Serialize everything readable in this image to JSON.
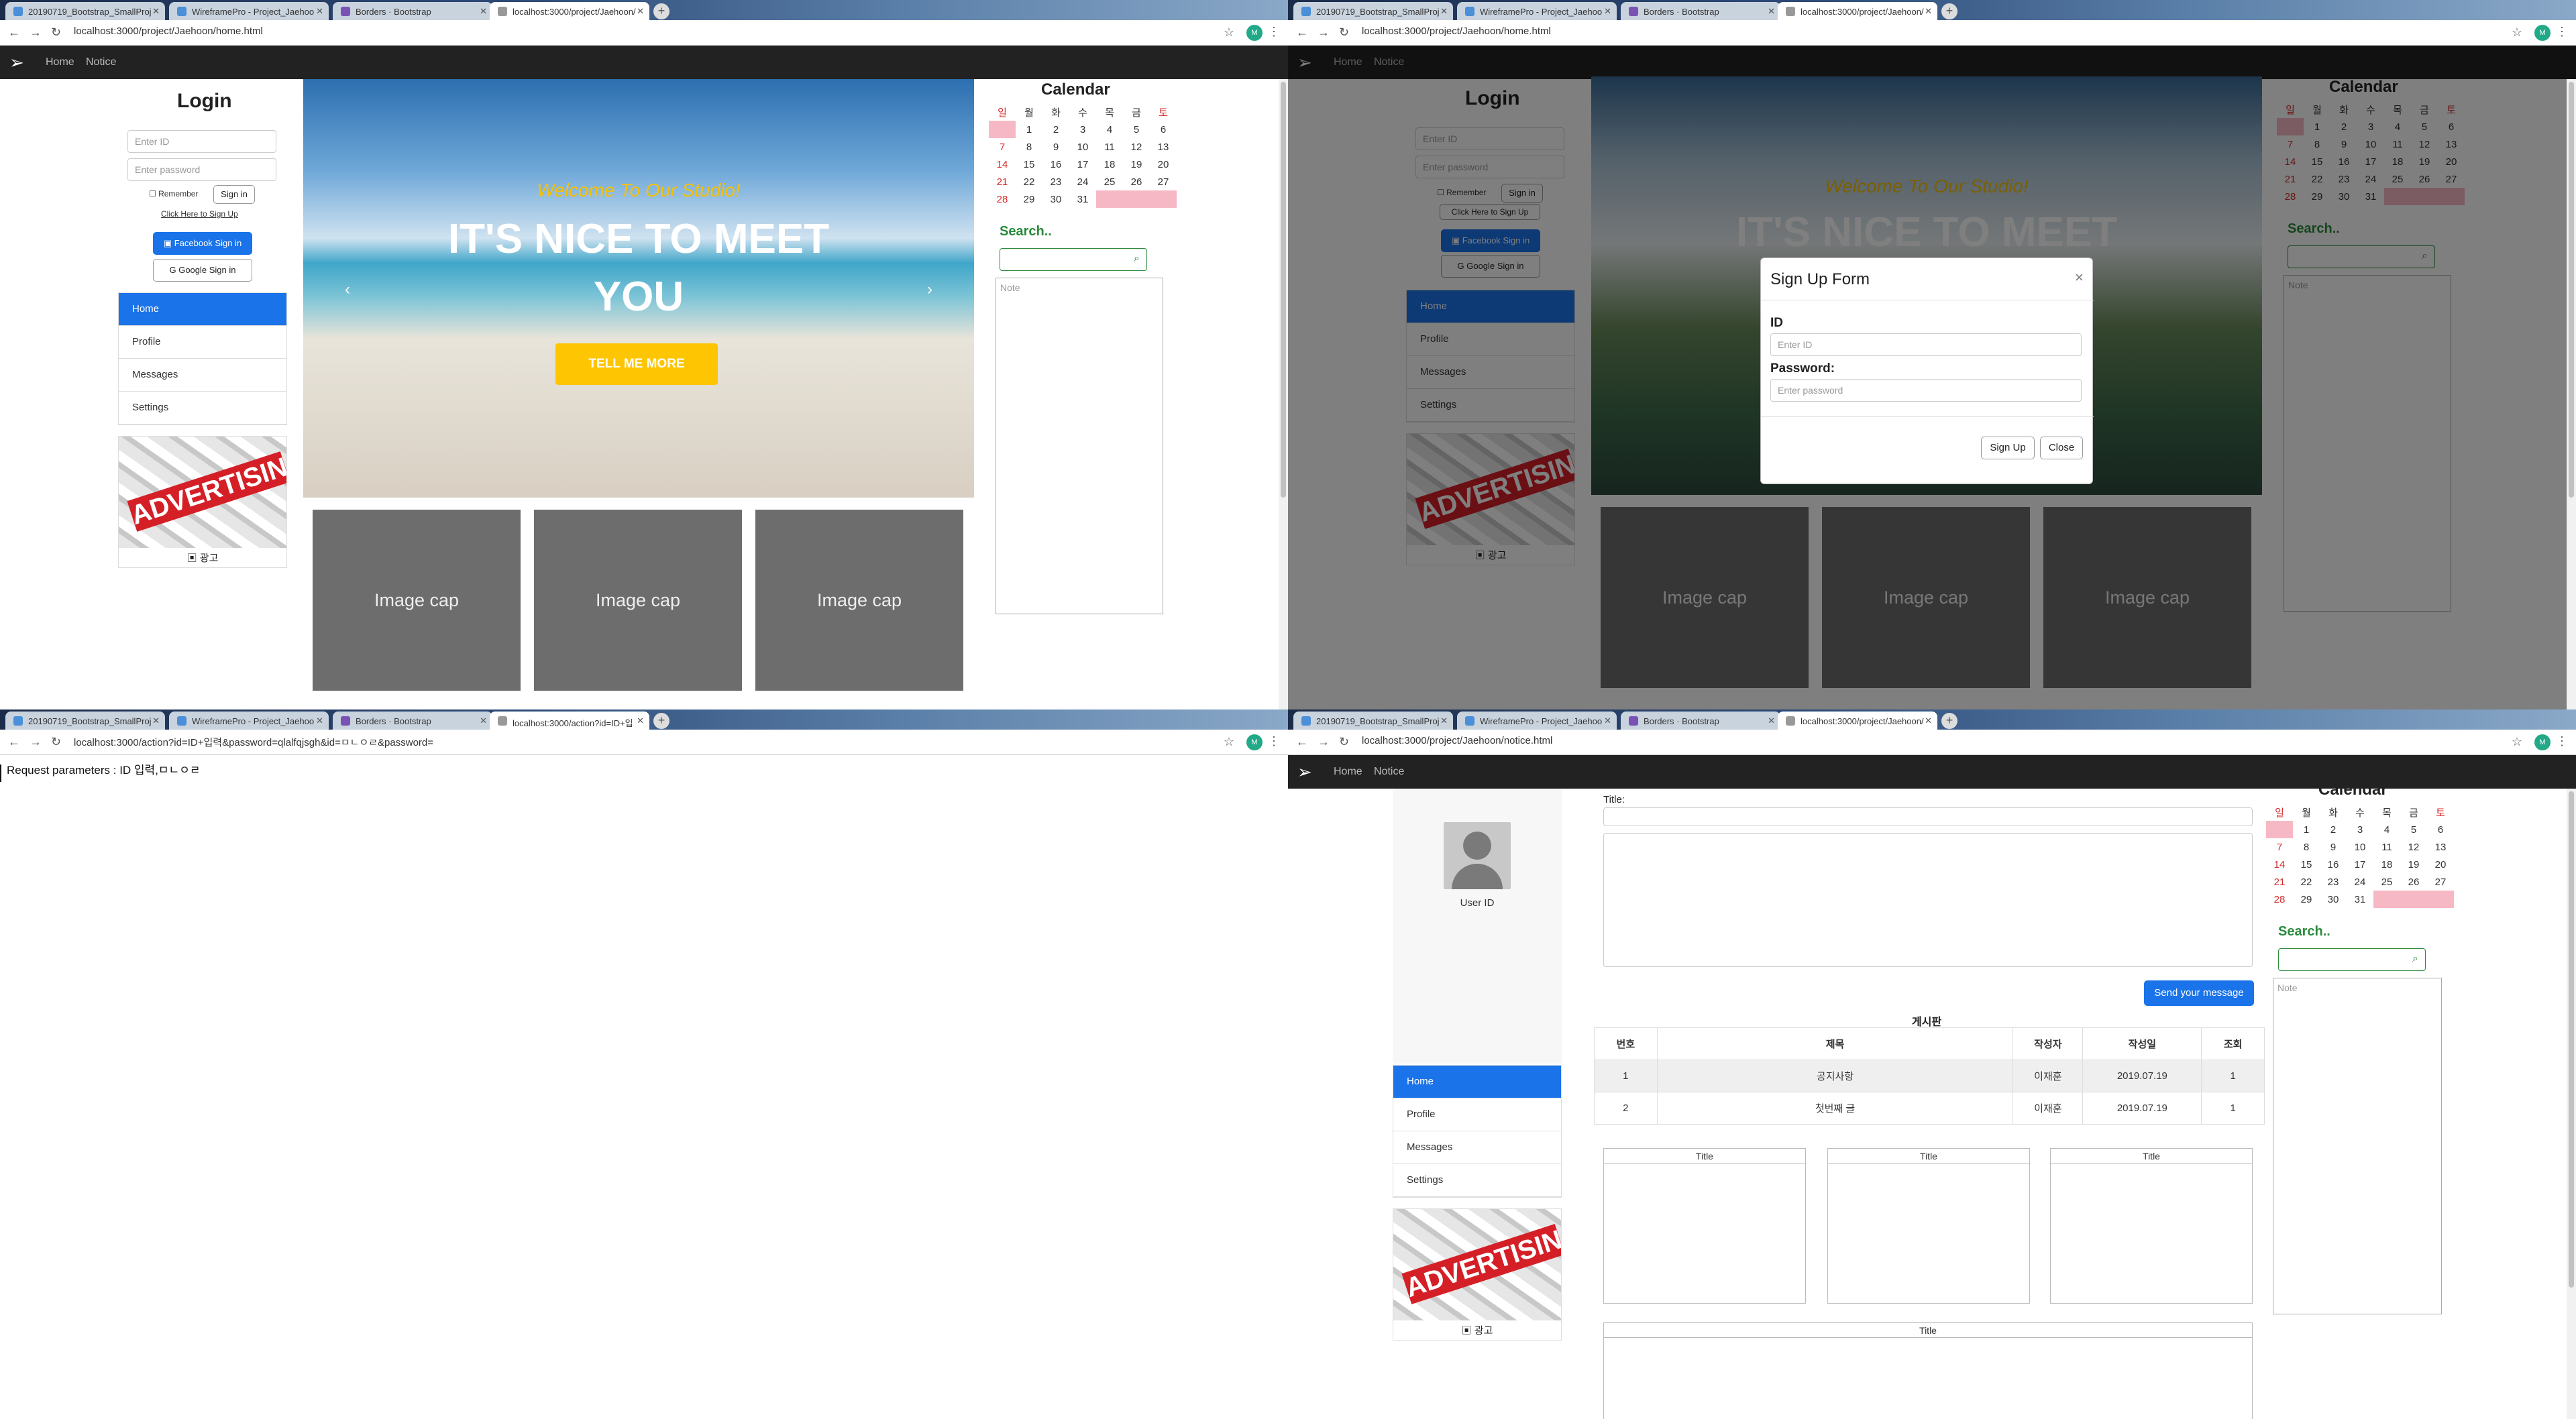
{
  "browser": {
    "tabs": [
      {
        "label": "20190719_Bootstrap_SmallProj"
      },
      {
        "label": "WireframePro - Project_Jaehoo"
      },
      {
        "label": "Borders · Bootstrap"
      },
      {
        "label": "localhost:3000/project/Jaehoon/"
      }
    ],
    "url_home": "localhost:3000/project/Jaehoon/home.html",
    "url_action": "localhost:3000/action?id=ID+입력&password=qlalfqjsgh&id=ㅁㄴㅇㄹ&password=",
    "url_notice": "localhost:3000/project/Jaehoon/notice.html",
    "url_action_tab": "localhost:3000/action?id=ID+입"
  },
  "navbar": {
    "home": "Home",
    "notice": "Notice"
  },
  "login": {
    "title": "Login",
    "id_placeholder": "Enter ID",
    "pw_placeholder": "Enter password",
    "remember": "Remember",
    "signin": "Sign in",
    "signup_link": "Click Here to Sign Up",
    "facebook": "Facebook Sign in",
    "google": "Google Sign in"
  },
  "sidemenu": {
    "items": [
      "Home",
      "Profile",
      "Messages",
      "Settings"
    ]
  },
  "ad": {
    "label": "ADVERTISING",
    "caption": "광고"
  },
  "hero": {
    "welcome": "Welcome To Our Studio!",
    "headline": "IT'S NICE TO MEET YOU",
    "button": "TELL ME MORE"
  },
  "cards": [
    "Image cap",
    "Image cap",
    "Image cap"
  ],
  "calendar": {
    "title": "Calendar",
    "weekdays": [
      "일",
      "월",
      "화",
      "수",
      "목",
      "금",
      "토"
    ],
    "weeks": [
      [
        "",
        "1",
        "2",
        "3",
        "4",
        "5",
        "6"
      ],
      [
        "7",
        "8",
        "9",
        "10",
        "11",
        "12",
        "13"
      ],
      [
        "14",
        "15",
        "16",
        "17",
        "18",
        "19",
        "20"
      ],
      [
        "21",
        "22",
        "23",
        "24",
        "25",
        "26",
        "27"
      ],
      [
        "28",
        "29",
        "30",
        "31",
        "",
        "",
        ""
      ]
    ]
  },
  "search": {
    "label": "Search..",
    "note_placeholder": "Note"
  },
  "modal": {
    "title": "Sign Up Form",
    "id_label": "ID",
    "id_placeholder": "Enter ID",
    "pw_label": "Password:",
    "pw_placeholder": "Enter password",
    "signup": "Sign Up",
    "close": "Close"
  },
  "action_page": {
    "text": "Request parameters : ID 입력,ㅁㄴㅇㄹ"
  },
  "notice": {
    "user_id": "User ID",
    "title_label": "Title:",
    "send": "Send your message",
    "board_title": "게시판",
    "columns": [
      "번호",
      "제목",
      "작성자",
      "작성일",
      "조회"
    ],
    "rows": [
      [
        "1",
        "공지사항",
        "이재훈",
        "2019.07.19",
        "1"
      ],
      [
        "2",
        "첫번째 글",
        "이재훈",
        "2019.07.19",
        "1"
      ]
    ],
    "box_title": "Title"
  },
  "colors": {
    "primary": "#1a73e8",
    "navbar": "#222222",
    "accent": "#fec503",
    "search": "#2a8a3b",
    "holiday": "#d62b2b"
  }
}
